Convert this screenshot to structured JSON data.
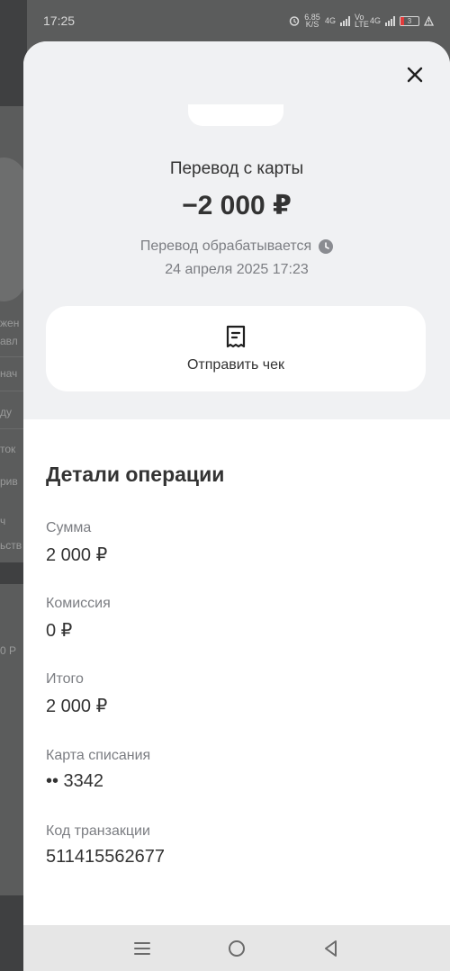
{
  "status_bar": {
    "time": "17:25",
    "net_speed": "6.85 K/S",
    "network_1": "4G",
    "volte": "Vo LTE",
    "network_2": "4G",
    "battery": "3"
  },
  "background": {
    "fragments": [
      "жен",
      "авл",
      "нач",
      "ду",
      "ток",
      "рив",
      "ч",
      "ьств",
      "0 Р"
    ]
  },
  "sheet": {
    "close_icon": "close-icon",
    "title": "Перевод с карты",
    "amount": "−2 000 ₽",
    "status": "Перевод обрабатывается",
    "status_icon": "clock-icon",
    "date": "24 апреля 2025 17:23",
    "receipt_action": {
      "icon": "receipt-icon",
      "label": "Отправить чек"
    }
  },
  "details": {
    "title": "Детали операции",
    "items": [
      {
        "label": "Сумма",
        "value": "2 000 ₽"
      },
      {
        "label": "Комиссия",
        "value": "0 ₽"
      },
      {
        "label": "Итого",
        "value": "2 000 ₽"
      },
      {
        "label": "Карта списания",
        "value": "•• 3342"
      },
      {
        "label": "Код транзакции",
        "value": "511415562677"
      }
    ]
  },
  "nav_bar": {
    "items": [
      "menu-icon",
      "home-icon",
      "back-icon"
    ]
  },
  "colors": {
    "sheet_top": "#f0f1f3",
    "card": "#ffffff",
    "text_primary": "#333333",
    "text_secondary": "#7b7d82",
    "overlay": "#5b5c5c"
  }
}
